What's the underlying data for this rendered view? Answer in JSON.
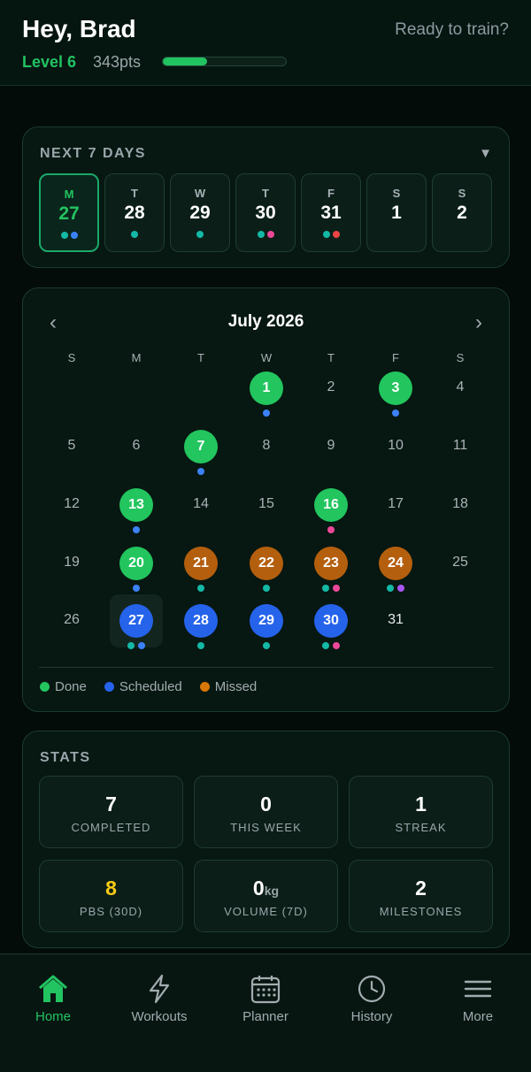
{
  "header": {
    "greeting": "Hey, Brad",
    "subtitle": "Ready to train?",
    "level": "Level 6",
    "points": "343pts",
    "xp_progress": 0.36
  },
  "colors": {
    "accent": "#22c361",
    "done": "#22c55e",
    "scheduled": "#2563eb",
    "missed": "#b45f0e",
    "dot_teal": "#14b8a6",
    "dot_blue": "#3b82f6",
    "dot_pink": "#ec4899",
    "dot_red": "#ef4444",
    "dot_purple": "#a855f7",
    "stat_highlight": "#facc15"
  },
  "next7": {
    "title": "NEXT 7 DAYS",
    "toggle_icon": "triangle-down-icon",
    "days": [
      {
        "dow": "M",
        "num": "27",
        "today": true,
        "dots": [
          "dot_teal",
          "dot_blue"
        ]
      },
      {
        "dow": "T",
        "num": "28",
        "today": false,
        "dots": [
          "dot_teal"
        ]
      },
      {
        "dow": "W",
        "num": "29",
        "today": false,
        "dots": [
          "dot_teal"
        ]
      },
      {
        "dow": "T",
        "num": "30",
        "today": false,
        "dots": [
          "dot_teal",
          "dot_pink"
        ]
      },
      {
        "dow": "F",
        "num": "31",
        "today": false,
        "dots": [
          "dot_teal",
          "dot_red"
        ]
      },
      {
        "dow": "S",
        "num": "1",
        "today": false,
        "dots": []
      },
      {
        "dow": "S",
        "num": "2",
        "today": false,
        "dots": []
      }
    ]
  },
  "calendar": {
    "month_label": "July 2026",
    "prev_icon": "chevron-left-icon",
    "next_icon": "chevron-right-icon",
    "weekdays": [
      "S",
      "M",
      "T",
      "W",
      "T",
      "F",
      "S"
    ],
    "first_weekday": 3,
    "days": [
      {
        "d": "1",
        "status": "done",
        "dots": [
          "dot_blue"
        ]
      },
      {
        "d": "2",
        "status": "",
        "dots": []
      },
      {
        "d": "3",
        "status": "done",
        "dots": [
          "dot_blue"
        ]
      },
      {
        "d": "4",
        "status": "",
        "dots": []
      },
      {
        "d": "5",
        "status": "",
        "dots": []
      },
      {
        "d": "6",
        "status": "",
        "dots": []
      },
      {
        "d": "7",
        "status": "done",
        "dots": [
          "dot_blue"
        ]
      },
      {
        "d": "8",
        "status": "",
        "dots": []
      },
      {
        "d": "9",
        "status": "",
        "dots": []
      },
      {
        "d": "10",
        "status": "",
        "dots": []
      },
      {
        "d": "11",
        "status": "",
        "dots": []
      },
      {
        "d": "12",
        "status": "",
        "dots": []
      },
      {
        "d": "13",
        "status": "done",
        "dots": [
          "dot_blue"
        ]
      },
      {
        "d": "14",
        "status": "",
        "dots": []
      },
      {
        "d": "15",
        "status": "",
        "dots": []
      },
      {
        "d": "16",
        "status": "done",
        "dots": [
          "dot_pink"
        ]
      },
      {
        "d": "17",
        "status": "",
        "dots": []
      },
      {
        "d": "18",
        "status": "",
        "dots": []
      },
      {
        "d": "19",
        "status": "",
        "dots": []
      },
      {
        "d": "20",
        "status": "done",
        "dots": [
          "dot_blue"
        ]
      },
      {
        "d": "21",
        "status": "missed",
        "dots": [
          "dot_teal"
        ]
      },
      {
        "d": "22",
        "status": "missed",
        "dots": [
          "dot_teal"
        ]
      },
      {
        "d": "23",
        "status": "missed",
        "dots": [
          "dot_teal",
          "dot_pink"
        ]
      },
      {
        "d": "24",
        "status": "missed",
        "dots": [
          "dot_teal",
          "dot_purple"
        ]
      },
      {
        "d": "25",
        "status": "",
        "dots": []
      },
      {
        "d": "26",
        "status": "",
        "dots": []
      },
      {
        "d": "27",
        "status": "scheduled",
        "selected": true,
        "dots": [
          "dot_teal",
          "dot_blue"
        ]
      },
      {
        "d": "28",
        "status": "scheduled",
        "dots": [
          "dot_teal"
        ]
      },
      {
        "d": "29",
        "status": "scheduled",
        "dots": [
          "dot_teal"
        ]
      },
      {
        "d": "30",
        "status": "scheduled",
        "dots": [
          "dot_teal",
          "dot_pink"
        ]
      },
      {
        "d": "31",
        "status": "",
        "bright": true,
        "dots": []
      }
    ],
    "legend": [
      {
        "label": "Done",
        "color": "done"
      },
      {
        "label": "Scheduled",
        "color": "scheduled"
      },
      {
        "label": "Missed",
        "color": "missed_legend"
      }
    ],
    "legend_colors": {
      "done": "#22c55e",
      "scheduled": "#2563eb",
      "missed_legend": "#d97706"
    }
  },
  "stats": {
    "title": "STATS",
    "items": [
      {
        "value": "7",
        "unit": "",
        "label": "COMPLETED",
        "highlight": false
      },
      {
        "value": "0",
        "unit": "",
        "label": "THIS WEEK",
        "highlight": false
      },
      {
        "value": "1",
        "unit": "",
        "label": "STREAK",
        "highlight": false
      },
      {
        "value": "8",
        "unit": "",
        "label": "PBS (30D)",
        "highlight": true
      },
      {
        "value": "0",
        "unit": "kg",
        "label": "VOLUME (7D)",
        "highlight": false
      },
      {
        "value": "2",
        "unit": "",
        "label": "MILESTONES",
        "highlight": false
      }
    ]
  },
  "nav": {
    "items": [
      {
        "label": "Home",
        "icon": "home-icon",
        "active": true
      },
      {
        "label": "Workouts",
        "icon": "lightning-icon",
        "active": false
      },
      {
        "label": "Planner",
        "icon": "calendar-icon",
        "active": false
      },
      {
        "label": "History",
        "icon": "clock-icon",
        "active": false
      },
      {
        "label": "More",
        "icon": "menu-icon",
        "active": false
      }
    ]
  }
}
